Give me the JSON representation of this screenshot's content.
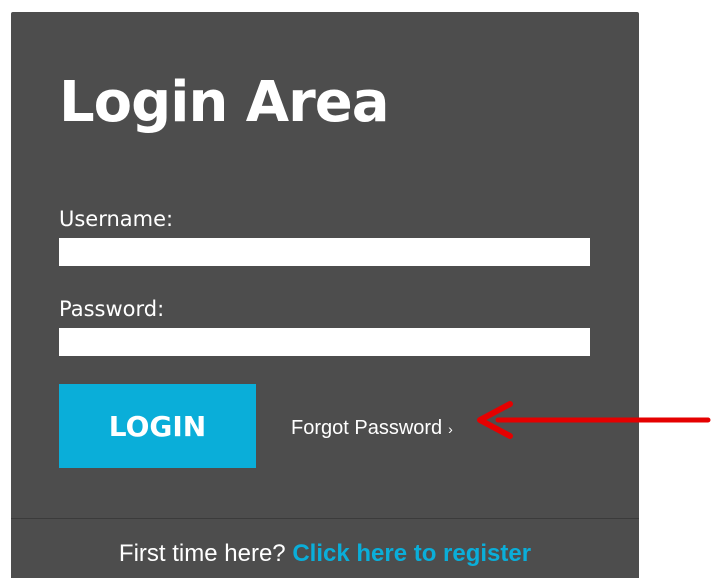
{
  "login": {
    "title": "Login Area",
    "username_label": "Username:",
    "username_value": "",
    "password_label": "Password:",
    "password_value": "",
    "login_button": "LOGIN",
    "forgot_password": "Forgot Password",
    "forgot_icon": "chevron-right-icon"
  },
  "footer": {
    "prompt": "First time here?",
    "register_link": "Click here to register"
  },
  "annotation": {
    "icon": "red-arrow-icon",
    "color": "#e50000"
  },
  "colors": {
    "panel": "#4d4d4d",
    "accent": "#0aaed9",
    "text": "#ffffff"
  }
}
